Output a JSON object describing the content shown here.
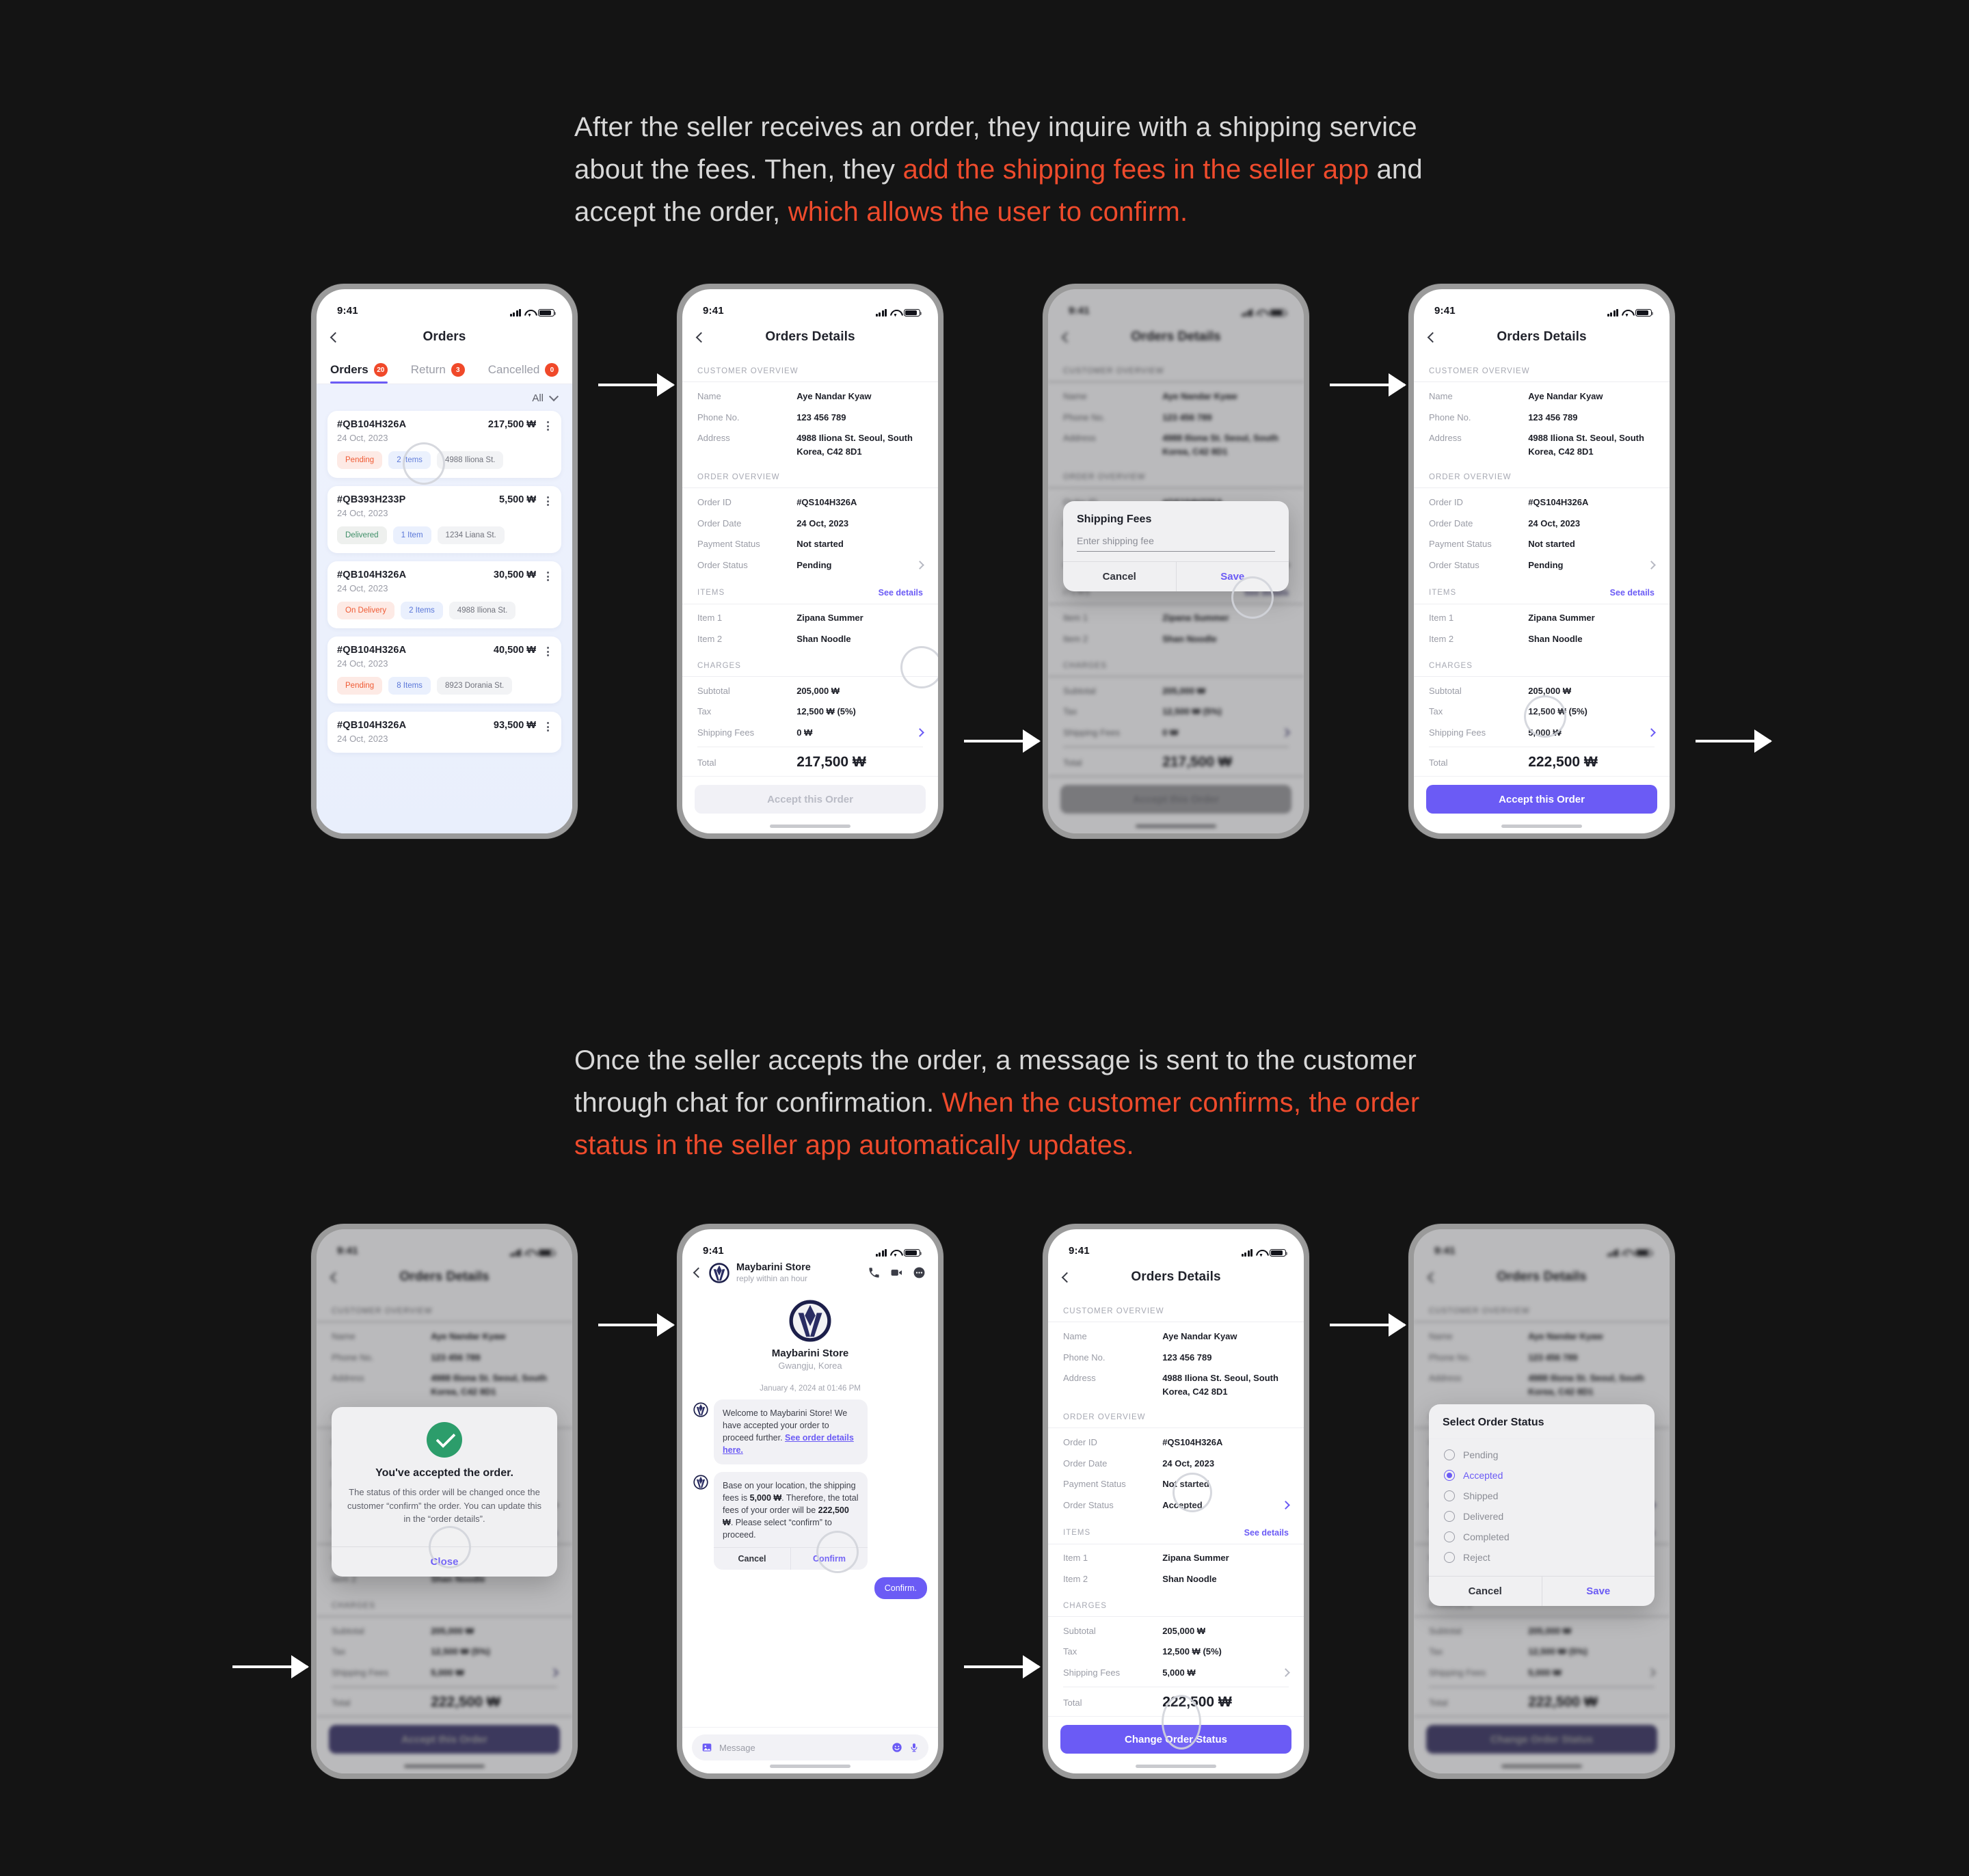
{
  "captions": {
    "one": {
      "part1": "After the seller receives an order, they inquire with a shipping service about the fees. Then, they ",
      "hl1": "add the shipping fees in the seller app",
      "part2": " and accept the order, ",
      "hl2": "which allows the user to confirm."
    },
    "two": {
      "part1": "Once the seller accepts the order, a message is sent to the customer through chat for confirmation. ",
      "hl1": "When the customer confirms, the order status in the seller app automatically updates."
    }
  },
  "colors": {
    "accent": "#6b5bf5",
    "highlight": "#ef4b2c",
    "badge": "#f0492a",
    "success": "#2c9d6b",
    "background": "#141414"
  },
  "statusbar": {
    "time": "9:41"
  },
  "screen1": {
    "title": "Orders",
    "tabs": [
      {
        "label": "Orders",
        "badge": "20",
        "active": true
      },
      {
        "label": "Return",
        "badge": "3",
        "active": false
      },
      {
        "label": "Cancelled",
        "badge": "0",
        "active": false
      }
    ],
    "filter": "All",
    "orders": [
      {
        "id": "#QB104H326A",
        "date": "24 Oct, 2023",
        "amount": "217,500 ₩",
        "status": "Pending",
        "status_kind": "pending",
        "items": "2 Items",
        "address": "4988 Iliona St."
      },
      {
        "id": "#QB393H233P",
        "date": "24 Oct, 2023",
        "amount": "5,500 ₩",
        "status": "Delivered",
        "status_kind": "delivered",
        "items": "1 Item",
        "address": "1234 Liana St."
      },
      {
        "id": "#QB104H326A",
        "date": "24 Oct, 2023",
        "amount": "30,500 ₩",
        "status": "On Delivery",
        "status_kind": "ondelivery",
        "items": "2 Items",
        "address": "4988 Iliona St."
      },
      {
        "id": "#QB104H326A",
        "date": "24 Oct, 2023",
        "amount": "40,500 ₩",
        "status": "Pending",
        "status_kind": "pending",
        "items": "8 Items",
        "address": "8923 Dorania St."
      },
      {
        "id": "#QB104H326A",
        "date": "24 Oct, 2023",
        "amount": "93,500 ₩",
        "status": "",
        "status_kind": "",
        "items": "",
        "address": ""
      }
    ]
  },
  "details": {
    "title": "Orders Details",
    "customer_heading": "CUSTOMER OVERVIEW",
    "order_heading": "ORDER OVERVIEW",
    "items_heading": "ITEMS",
    "charges_heading": "CHARGES",
    "see_details": "See details",
    "labels": {
      "name": "Name",
      "phone": "Phone No.",
      "address": "Address",
      "order_id": "Order ID",
      "order_date": "Order Date",
      "payment_status": "Payment Status",
      "order_status": "Order Status",
      "item1": "Item 1",
      "item2": "Item 2",
      "subtotal": "Subtotal",
      "tax": "Tax",
      "shipping": "Shipping Fees",
      "total": "Total"
    },
    "values": {
      "name": "Aye Nandar Kyaw",
      "phone": "123 456 789",
      "address": "4988 Iliona St. Seoul, South Korea, C42 8D1",
      "order_id": "#QS104H326A",
      "order_date": "24 Oct, 2023",
      "payment_status": "Not started",
      "item1": "Zipana Summer",
      "item2": "Shan Noodle",
      "subtotal": "205,000 ₩",
      "tax": "12,500 ₩ (5%)"
    },
    "before": {
      "order_status": "Pending",
      "shipping": "0 ₩",
      "total": "217,500 ₩",
      "cta": "Accept this Order"
    },
    "after": {
      "order_status": "Pending",
      "shipping": "5,000 ₩",
      "total": "222,500 ₩",
      "cta": "Accept this Order"
    },
    "accepted": {
      "order_status": "Accepted",
      "shipping": "5,000 ₩",
      "total": "222,500 ₩",
      "cta": "Change Order Status"
    }
  },
  "shipping_modal": {
    "title": "Shipping Fees",
    "placeholder": "Enter shipping fee",
    "cancel": "Cancel",
    "save": "Save"
  },
  "success_modal": {
    "title": "You've accepted the order.",
    "text": "The status of this order will be changed once the customer “confirm” the order. You can update this in the “order details”.",
    "close": "Close"
  },
  "status_modal": {
    "title": "Select Order Status",
    "options": [
      {
        "label": "Pending",
        "selected": false
      },
      {
        "label": "Accepted",
        "selected": true
      },
      {
        "label": "Shipped",
        "selected": false
      },
      {
        "label": "Delivered",
        "selected": false
      },
      {
        "label": "Completed",
        "selected": false
      },
      {
        "label": "Reject",
        "selected": false
      }
    ],
    "cancel": "Cancel",
    "save": "Save"
  },
  "chat": {
    "store_name": "Maybarini Store",
    "reply_time": "reply within an hour",
    "hero_name": "Maybarini Store",
    "hero_location": "Gwangju, Korea",
    "timestamp": "January 4, 2024 at 01:46 PM",
    "msg1_a": "Welcome to Maybarini Store! We have accepted your order to proceed further. ",
    "msg1_link": "See order details here.",
    "msg2_a": "Base on your location, the shipping fees is ",
    "msg2_b": "5,000 ₩",
    "msg2_c": ". Therefore, the total fees of your order will be ",
    "msg2_d": "222,500 ₩",
    "msg2_e": ". Please select “confirm” to proceed.",
    "cancel": "Cancel",
    "confirm": "Confirm",
    "sent_reply": "Confirm.",
    "composer_placeholder": "Message"
  }
}
